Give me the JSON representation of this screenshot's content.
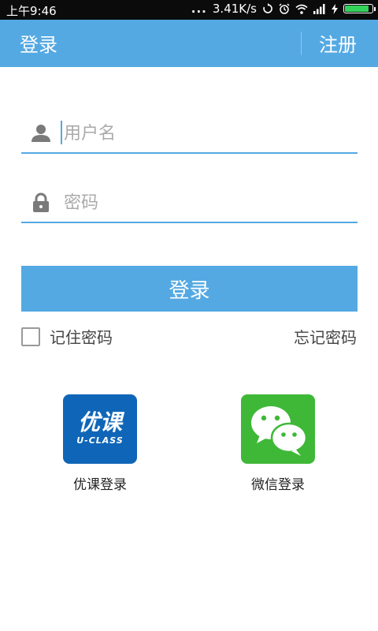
{
  "status_bar": {
    "time": "上午9:46",
    "dots": "...",
    "network_speed": "3.41K/s",
    "battery_level": 0.9
  },
  "header": {
    "title": "登录",
    "register_label": "注册"
  },
  "form": {
    "username_placeholder": "用户名",
    "password_placeholder": "密码",
    "login_button": "登录",
    "remember_label": "记住密码",
    "forgot_label": "忘记密码"
  },
  "social": {
    "uclass": {
      "label": "优课登录",
      "logo_text": "优课",
      "logo_subtext": "U-CLASS"
    },
    "wechat": {
      "label": "微信登录"
    }
  },
  "colors": {
    "accent": "#54a9e3",
    "uclass_blue": "#0f66b8",
    "wechat_green": "#3fb838"
  }
}
